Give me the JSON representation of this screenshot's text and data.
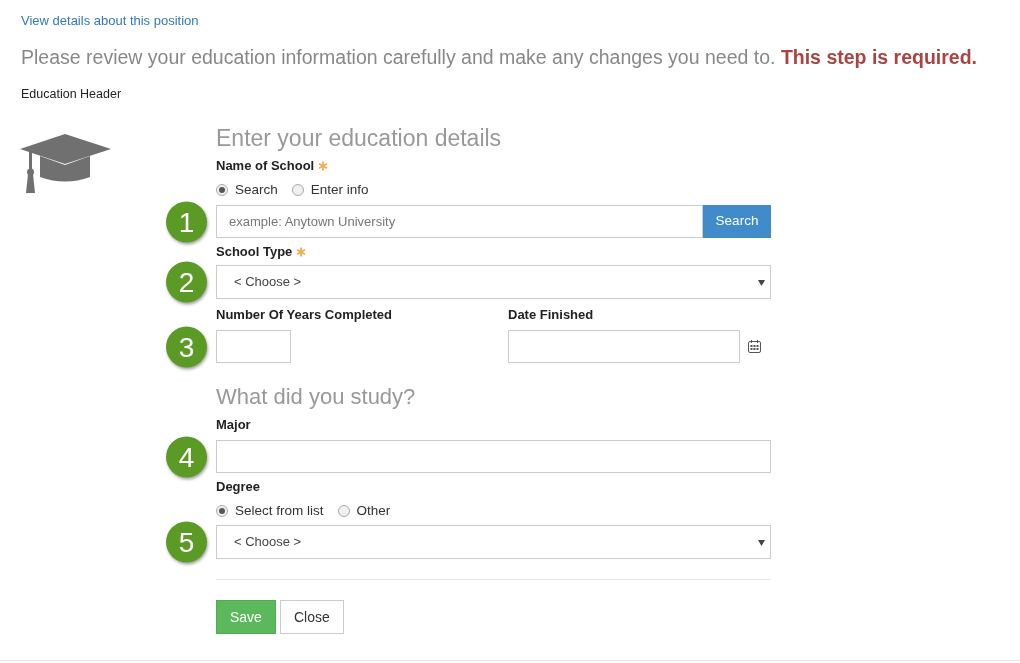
{
  "link": "View details about this position",
  "intro": "Please review your education information carefully and make any changes you need to. **This step is required.**",
  "section_header": "Education Header",
  "form": {
    "title": "Enter your education details",
    "items": [
      {
        "kind": "label",
        "text": "Name of School",
        "required": true
      },
      {
        "kind": "radios",
        "options": [
          {
            "label": "Search",
            "selected": true
          },
          {
            "label": "Enter info",
            "selected": false
          }
        ]
      },
      {
        "kind": "search",
        "badge": "1",
        "placeholder": "example: Anytown University",
        "button": "Search"
      },
      {
        "kind": "label",
        "text": "School Type",
        "required": true
      },
      {
        "kind": "select",
        "badge": "2",
        "value": "< Choose >"
      },
      {
        "kind": "pair",
        "badge": "3",
        "left": "Number Of Years Completed",
        "right": "Date Finished"
      },
      {
        "kind": "heading",
        "text": "What did you study?"
      },
      {
        "kind": "label",
        "text": "Major",
        "required": false
      },
      {
        "kind": "input",
        "badge": "4"
      },
      {
        "kind": "label",
        "text": "Degree",
        "required": false
      },
      {
        "kind": "radios",
        "options": [
          {
            "label": "Select from list",
            "selected": true
          },
          {
            "label": "Other",
            "selected": false
          }
        ]
      },
      {
        "kind": "select",
        "badge": "5",
        "value": "< Choose >"
      }
    ],
    "buttons": [
      {
        "label": "Save",
        "kind": "primary"
      },
      {
        "label": "Close",
        "kind": "default"
      }
    ]
  }
}
